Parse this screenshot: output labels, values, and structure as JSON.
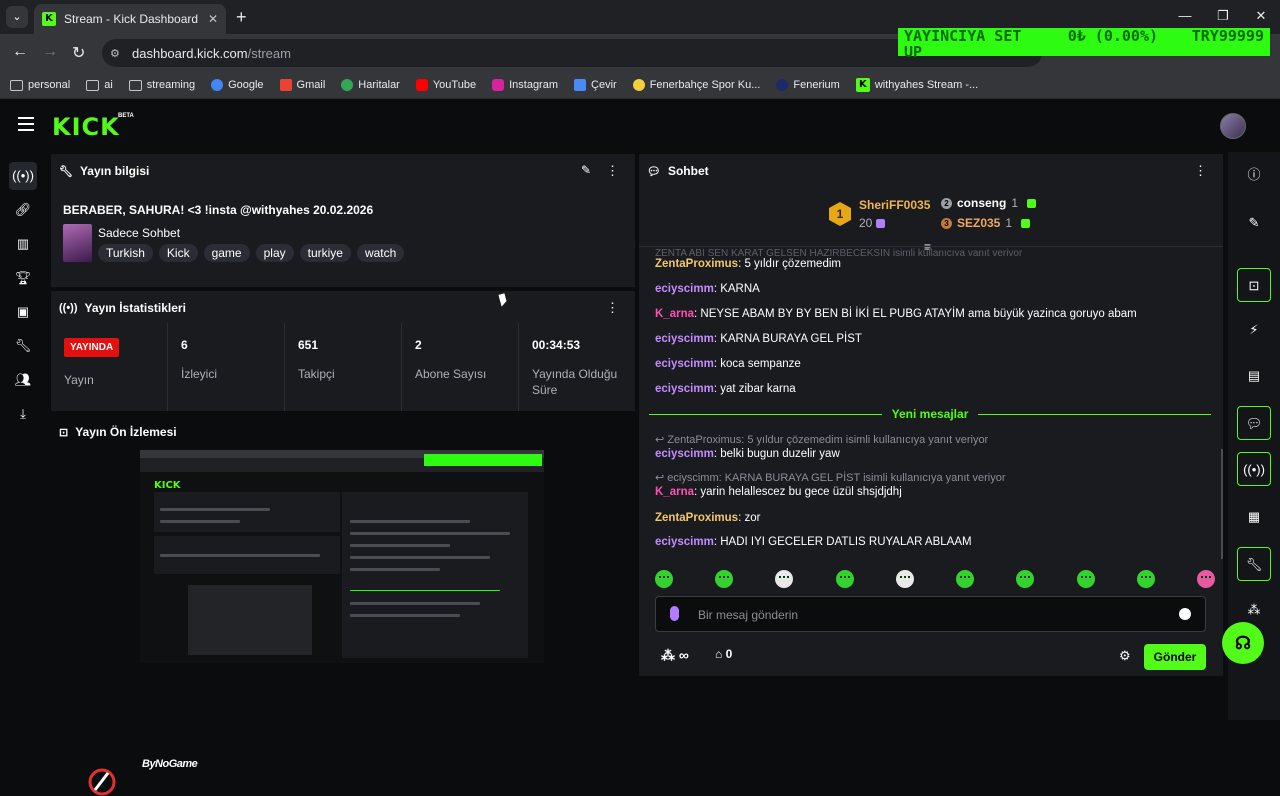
{
  "browser": {
    "tab_title": "Stream - Kick Dashboard",
    "url_host": "dashboard.kick.com",
    "url_path": "/stream",
    "bookmarks": [
      "personal",
      "ai",
      "streaming",
      "Google",
      "Gmail",
      "Haritalar",
      "YouTube",
      "Instagram",
      "Çevir",
      "Fenerbahçe Spor Ku...",
      "Fenerium",
      "withyahes Stream -..."
    ]
  },
  "ticker": {
    "label": "YAYINCIYA SET UP",
    "amount": "0₺ (0.00%)",
    "goal": "TRY99999"
  },
  "app": {
    "logo": "KICK",
    "beta": "BETA"
  },
  "stream_info": {
    "heading": "Yayın bilgisi",
    "title": "BERABER, SAHURA! <3 !insta @withyahes 20.02.2026",
    "category": "Sadece Sohbet",
    "category_art": "JUST CHATTING",
    "tags": [
      "Turkish",
      "Kick",
      "game",
      "play",
      "turkiye",
      "watch"
    ]
  },
  "stats": {
    "heading": "Yayın İstatistikleri",
    "live_badge": "YAYINDA",
    "live_label": "Yayın",
    "items": [
      {
        "value": "6",
        "label": "İzleyici"
      },
      {
        "value": "651",
        "label": "Takipçi"
      },
      {
        "value": "2",
        "label": "Abone Sayısı"
      },
      {
        "value": "00:34:53",
        "label": "Yayında Olduğu Süre"
      }
    ]
  },
  "preview": {
    "heading": "Yayın Ön İzlemesi",
    "brand": "ByNoGame"
  },
  "chat": {
    "heading": "Sohbet",
    "leader": {
      "rank": "1",
      "name": "SheriFF0035",
      "count": "20"
    },
    "ranks": [
      {
        "name": "conseng",
        "count": "1"
      },
      {
        "name": "SEZ035",
        "count": "1"
      }
    ],
    "partial_top": "ZENTA ABI SEN KARAT GELSEN HAZIRBECEKSIN isimli kullanıcıya yanıt veriyor",
    "messages_old": [
      {
        "user": "ZentaProximus",
        "text": "5 yıldır çözemedim"
      },
      {
        "user": "eciyscimm",
        "text": "KARNA"
      },
      {
        "user": "K_arna",
        "text": "NEYSE ABAM BY BY BEN Bİ İKİ EL PUBG ATAYİM ama büyük yazinca goruyo abam"
      },
      {
        "user": "eciyscimm",
        "text": "KARNA BURAYA GEL PİST"
      },
      {
        "user": "eciyscimm",
        "text": "koca sempanze"
      },
      {
        "user": "eciyscimm",
        "text": "yat zibar karna"
      }
    ],
    "new_messages": "Yeni mesajlar",
    "replies": [
      "ZentaProximus: 5 yıldur çözemedim isimli kullanıcıya yanıt veriyor",
      "eciyscimm: KARNA BURAYA GEL PİST isimli kullanıcıya yanıt veriyor"
    ],
    "messages_new": [
      {
        "user": "eciyscimm",
        "text": "belki bugun duzelir yaw"
      },
      {
        "user": "K_arna",
        "text": "yarin helallescez bu gece üzül shsjdjdhj"
      },
      {
        "user": "ZentaProximus",
        "text": "zor"
      },
      {
        "user": "eciyscimm",
        "text": "HADI IYI GECELER DATLIS RUYALAR ABLAAM"
      }
    ],
    "input_placeholder": "Bir mesaj gönderin",
    "points": "∞",
    "store_count": "0",
    "send_label": "Gönder"
  },
  "colors": {
    "accent": "#53fc18",
    "live": "#e40f0f",
    "panel": "#191b1f"
  }
}
